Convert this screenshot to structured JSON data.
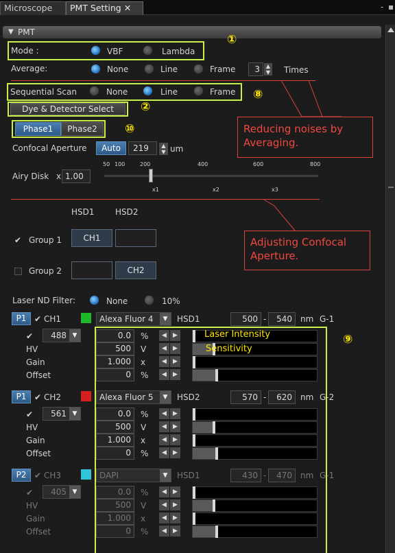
{
  "tabs": [
    {
      "label": "Microscope"
    },
    {
      "label": "PMT Setting"
    }
  ],
  "tab_close": "✕",
  "window_controls": {
    "minimize": "-",
    "restore": "▪"
  },
  "section": {
    "title": "PMT",
    "arrow": "▼"
  },
  "callouts": {
    "n1": "①",
    "n2": "②",
    "n8": "⑧",
    "n9": "⑨",
    "n10": "⑩"
  },
  "mode": {
    "label": "Mode :",
    "options": [
      "VBF",
      "Lambda"
    ],
    "selected": "VBF"
  },
  "average": {
    "label": "Average:",
    "options": [
      "None",
      "Line",
      "Frame"
    ],
    "selected": "None",
    "count": "3",
    "unit": "Times"
  },
  "sequential": {
    "label": "Sequential Scan",
    "options": [
      "None",
      "Line",
      "Frame"
    ],
    "selected": "Line"
  },
  "dye_button": "Dye & Detector Select",
  "phases": [
    "Phase1",
    "Phase2"
  ],
  "aperture": {
    "label": "Confocal Aperture",
    "auto": "Auto",
    "value": "219",
    "unit": "um",
    "scale": [
      "50",
      "100",
      "200",
      "400",
      "600",
      "800"
    ],
    "scale_value": 219
  },
  "airy": {
    "label": "Airy Disk",
    "prefix": "x",
    "value": "1.00",
    "scale": [
      "x1",
      "x2",
      "x3"
    ]
  },
  "annotations": {
    "averaging": "Reducing noises by Averaging.",
    "aperture": "Adjusting Confocal Aperture.",
    "laser_intensity": "Laser Intensity",
    "sensitivity": "Sensitivity"
  },
  "detectors": {
    "headers": [
      "HSD1",
      "HSD2"
    ]
  },
  "groups": [
    {
      "label": "Group 1",
      "checked": true,
      "check": "✔",
      "hsd1": "CH1",
      "hsd2": ""
    },
    {
      "label": "Group 2",
      "checked": false,
      "check": "",
      "hsd1": "",
      "hsd2": "CH2"
    }
  ],
  "laser_nd": {
    "label": "Laser ND Filter:",
    "options": [
      "None",
      "10%"
    ],
    "selected": "None"
  },
  "channels": [
    {
      "phase": "P1",
      "name": "CH1",
      "check": "✔",
      "color": "#1fb82a",
      "dye": "Alexa Fluor 4",
      "detector": "HSD1",
      "from": "500",
      "to": "540",
      "unit": "nm",
      "gain_id": "G-1",
      "laser": "488",
      "laser_check": "✔",
      "dim": false,
      "rows": [
        {
          "label": "",
          "value": "0.0",
          "unit": "%",
          "level": 0.0
        },
        {
          "label": "HV",
          "value": "500",
          "unit": "V",
          "level": 0.17
        },
        {
          "label": "Gain",
          "value": "1.000",
          "unit": "x",
          "level": 0.0
        },
        {
          "label": "Offset",
          "value": "0",
          "unit": "%",
          "level": 0.19
        }
      ]
    },
    {
      "phase": "P1",
      "name": "CH2",
      "check": "✔",
      "color": "#d6201e",
      "dye": "Alexa Fluor 5",
      "detector": "HSD2",
      "from": "570",
      "to": "620",
      "unit": "nm",
      "gain_id": "G-2",
      "laser": "561",
      "laser_check": "✔",
      "dim": false,
      "rows": [
        {
          "label": "",
          "value": "0.0",
          "unit": "%",
          "level": 0.0
        },
        {
          "label": "HV",
          "value": "500",
          "unit": "V",
          "level": 0.17
        },
        {
          "label": "Gain",
          "value": "1.000",
          "unit": "x",
          "level": 0.0
        },
        {
          "label": "Offset",
          "value": "0",
          "unit": "%",
          "level": 0.19
        }
      ]
    },
    {
      "phase": "P2",
      "name": "CH3",
      "check": "✔",
      "color": "#30c4d8",
      "dye": "DAPI",
      "detector": "HSD1",
      "from": "430",
      "to": "470",
      "unit": "nm",
      "gain_id": "G-1",
      "laser": "405",
      "laser_check": "✔",
      "dim": true,
      "rows": [
        {
          "label": "",
          "value": "0.0",
          "unit": "%",
          "level": 0.0
        },
        {
          "label": "HV",
          "value": "500",
          "unit": "V",
          "level": 0.17
        },
        {
          "label": "Gain",
          "value": "1.000",
          "unit": "x",
          "level": 0.0
        },
        {
          "label": "Offset",
          "value": "0",
          "unit": "%",
          "level": 0.19
        }
      ]
    }
  ],
  "colors": {
    "accent": "#c9f04a",
    "callout_num": "#ffe600",
    "annotation": "#f04840",
    "selected_radio": "#2a7cc8"
  }
}
